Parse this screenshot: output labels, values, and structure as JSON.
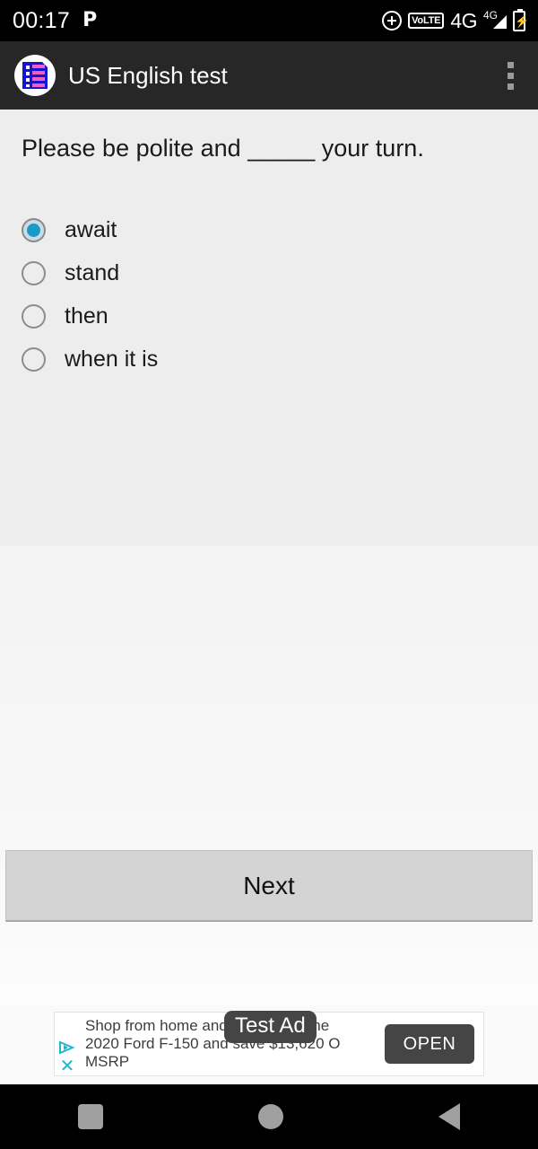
{
  "status_bar": {
    "clock": "00:17",
    "notification_icon_label": "P",
    "alarm_icon": "alarm-icon",
    "volte_label": "VoLTE",
    "network_label": "4G",
    "signal_label": "4G",
    "battery_icon": "battery-charging-icon"
  },
  "app_bar": {
    "title": "US English test",
    "logo_icon": "quiz-document-icon",
    "overflow_icon": "overflow-menu-icon"
  },
  "quiz": {
    "question": "Please be polite and _____ your turn.",
    "options": [
      {
        "label": "await",
        "selected": true
      },
      {
        "label": "stand",
        "selected": false
      },
      {
        "label": "then",
        "selected": false
      },
      {
        "label": "when it is",
        "selected": false
      }
    ],
    "next_label": "Next"
  },
  "ad": {
    "badge_label": "Test Ad",
    "line1": "Shop from home and shop brand ne",
    "line2": "2020 Ford F-150 and save $13,620 O",
    "line3": "MSRP",
    "open_label": "OPEN",
    "adchoices_icon": "adchoices-icon",
    "close_icon": "close-icon"
  },
  "nav_bar": {
    "recents_icon": "recents-square-icon",
    "home_icon": "home-circle-icon",
    "back_icon": "back-triangle-icon"
  },
  "colors": {
    "status_bar_bg": "#000000",
    "app_bar_bg": "#272727",
    "content_bg": "#ededed",
    "accent_radio": "#1b9ac7",
    "ad_accent": "#1fb6d4",
    "button_bg": "#d4d4d4"
  }
}
